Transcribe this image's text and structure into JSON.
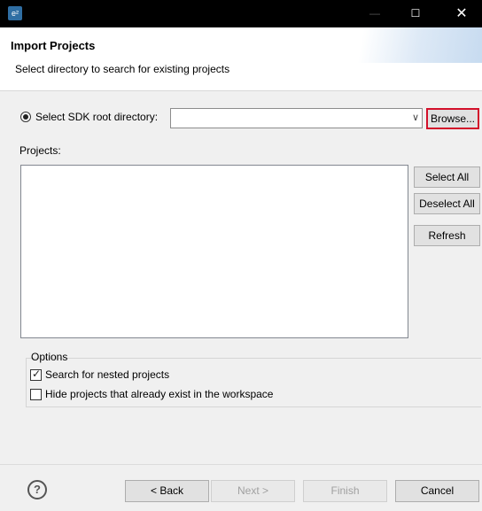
{
  "titlebar": {
    "app_icon_text": "e²",
    "minimize": "—",
    "maximize": "☐",
    "close": "✕"
  },
  "header": {
    "title": "Import Projects",
    "description": "Select directory to search for existing projects"
  },
  "sdk": {
    "radio_label": "Select SDK root directory:",
    "selected": true,
    "combo_value": "",
    "browse_label": "Browse..."
  },
  "projects": {
    "label": "Projects:",
    "items": [],
    "select_all_label": "Select All",
    "deselect_all_label": "Deselect All",
    "refresh_label": "Refresh"
  },
  "options": {
    "label": "Options",
    "nested_label": "Search for nested projects",
    "nested_checked": true,
    "hide_label": "Hide projects that already exist in the workspace",
    "hide_checked": false
  },
  "footer": {
    "help_text": "?",
    "back_label": "< Back",
    "next_label": "Next >",
    "finish_label": "Finish",
    "cancel_label": "Cancel"
  },
  "colors": {
    "highlight_border": "#d3102a",
    "titlebar": "#000000"
  }
}
